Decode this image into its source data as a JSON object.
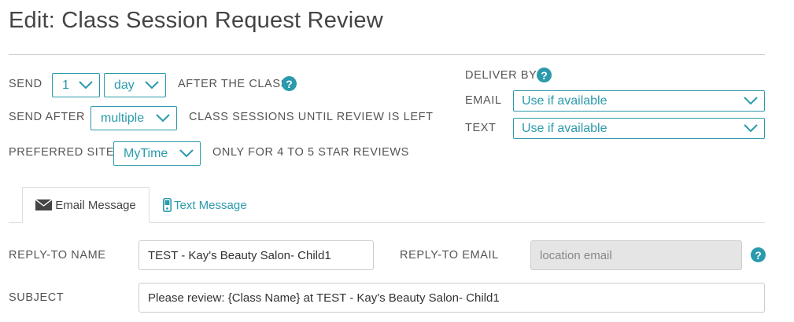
{
  "page_title": "Edit: Class Session Request Review",
  "send": {
    "label": "SEND",
    "count_value": "1",
    "unit_value": "day",
    "suffix": "AFTER THE CLASS"
  },
  "send_after": {
    "label": "SEND AFTER",
    "value": "multiple",
    "suffix": "CLASS SESSIONS UNTIL REVIEW IS LEFT"
  },
  "preferred_site": {
    "label": "PREFERRED SITE",
    "value": "MyTime",
    "suffix": "ONLY FOR 4 TO 5 STAR REVIEWS"
  },
  "deliver_by": {
    "label": "DELIVER BY",
    "email_label": "EMAIL",
    "email_value": "Use if available",
    "text_label": "TEXT",
    "text_value": "Use if available"
  },
  "tabs": [
    {
      "label": "Email Message",
      "icon": "envelope-icon",
      "active": true
    },
    {
      "label": "Text Message",
      "icon": "phone-icon",
      "active": false
    }
  ],
  "form": {
    "reply_to_name_label": "REPLY-TO NAME",
    "reply_to_name_value": "TEST - Kay's Beauty Salon- Child1",
    "reply_to_email_label": "REPLY-TO EMAIL",
    "reply_to_email_placeholder": "location email",
    "subject_label": "SUBJECT",
    "subject_value": "Please review: {Class Name} at TEST - Kay's Beauty Salon- Child1"
  },
  "help_glyph": "?",
  "colors": {
    "accent": "#2a9aac",
    "text": "#444444",
    "disabled_bg": "#e5e5e5"
  }
}
